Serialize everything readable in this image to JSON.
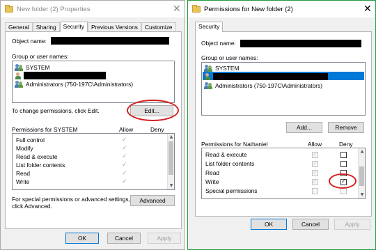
{
  "left_window": {
    "title": "New folder (2) Properties",
    "tabs": [
      {
        "label": "General"
      },
      {
        "label": "Sharing"
      },
      {
        "label": "Security",
        "active": true
      },
      {
        "label": "Previous Versions"
      },
      {
        "label": "Customize"
      }
    ],
    "object_name_label": "Object name:",
    "group_label": "Group or user names:",
    "users": [
      {
        "name": "SYSTEM",
        "icon": "users-group-icon"
      },
      {
        "name": "",
        "icon": "user-icon",
        "redacted": true
      },
      {
        "name": "Administrators (750-197C\\Administrators)",
        "icon": "users-group-icon"
      }
    ],
    "change_hint": "To change permissions, click Edit.",
    "edit_button": "Edit...",
    "permissions_for": "Permissions for SYSTEM",
    "allow_header": "Allow",
    "deny_header": "Deny",
    "permissions": [
      {
        "name": "Full control",
        "allow": true,
        "deny": false
      },
      {
        "name": "Modify",
        "allow": true,
        "deny": false
      },
      {
        "name": "Read & execute",
        "allow": true,
        "deny": false
      },
      {
        "name": "List folder contents",
        "allow": true,
        "deny": false
      },
      {
        "name": "Read",
        "allow": true,
        "deny": false
      },
      {
        "name": "Write",
        "allow": true,
        "deny": false
      }
    ],
    "special_hint_line1": "For special permissions or advanced settings,",
    "special_hint_line2": "click Advanced.",
    "advanced_button": "Advanced",
    "ok_button": "OK",
    "cancel_button": "Cancel",
    "apply_button": "Apply",
    "close_glyph": "✕"
  },
  "right_window": {
    "title": "Permissions for New folder (2)",
    "tabs": [
      {
        "label": "Security",
        "active": true
      }
    ],
    "object_name_label": "Object name:",
    "group_label": "Group or user names:",
    "users": [
      {
        "name": "SYSTEM",
        "icon": "users-group-icon"
      },
      {
        "name": "",
        "icon": "user-icon",
        "redacted": true,
        "selected": true
      },
      {
        "name": "Administrators (750-197C\\Administrators)",
        "icon": "users-group-icon"
      }
    ],
    "add_button": "Add...",
    "remove_button": "Remove",
    "permissions_for": "Permissions for Nathaniel",
    "allow_header": "Allow",
    "deny_header": "Deny",
    "permissions": [
      {
        "name": "Read & execute",
        "allow": true,
        "deny": false
      },
      {
        "name": "List folder contents",
        "allow": true,
        "deny": false
      },
      {
        "name": "Read",
        "allow": true,
        "deny": false
      },
      {
        "name": "Write",
        "allow": true,
        "deny": true
      },
      {
        "name": "Special permissions",
        "allow": false,
        "deny": false
      }
    ],
    "ok_button": "OK",
    "cancel_button": "Cancel",
    "apply_button": "Apply",
    "close_glyph": "✕"
  },
  "annotation_color": "#d42020"
}
